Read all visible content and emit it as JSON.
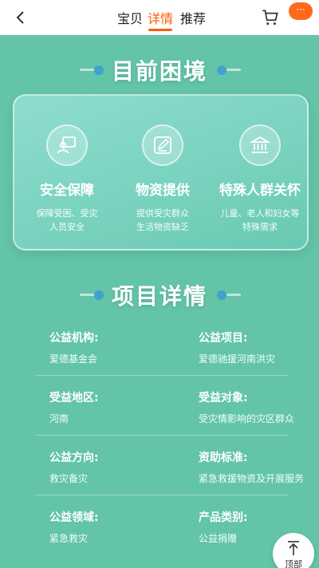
{
  "topbar": {
    "tabs": [
      "宝贝",
      "详情",
      "推荐"
    ],
    "active_tab": 1,
    "more_label": "···",
    "accent_color": "#ff5a00"
  },
  "intro": {
    "title": "目前困境",
    "features": [
      {
        "icon": "person-board-icon",
        "title": "安全保障",
        "desc": [
          "保障受困、受灾",
          "人员安全"
        ]
      },
      {
        "icon": "edit-note-icon",
        "title": "物资提供",
        "desc": [
          "提供受灾群众",
          "生活物资缺乏"
        ]
      },
      {
        "icon": "bank-building-icon",
        "title": "特殊人群关怀",
        "desc": [
          "儿童、老人和妇女等",
          "特殊需求"
        ]
      }
    ]
  },
  "details": {
    "title": "项目详情",
    "rows": [
      [
        {
          "label": "公益机构:",
          "value": "爱德基金会"
        },
        {
          "label": "公益项目:",
          "value": "爱德驰援河南洪灾"
        }
      ],
      [
        {
          "label": "受益地区:",
          "value": "河南"
        },
        {
          "label": "受益对象:",
          "value": "受灾情影响的灾区群众"
        }
      ],
      [
        {
          "label": "公益方向:",
          "value": "救灾备灾"
        },
        {
          "label": "资助标准:",
          "value": "紧急救援物资及开展服务"
        }
      ],
      [
        {
          "label": "公益领域:",
          "value": "紧急救灾"
        },
        {
          "label": "产品类别:",
          "value": "公益捐赠"
        }
      ]
    ]
  },
  "back_to_top": {
    "label": "顶部"
  },
  "colors": {
    "background": "#63c4a8",
    "dot": "#3fa4c9"
  }
}
